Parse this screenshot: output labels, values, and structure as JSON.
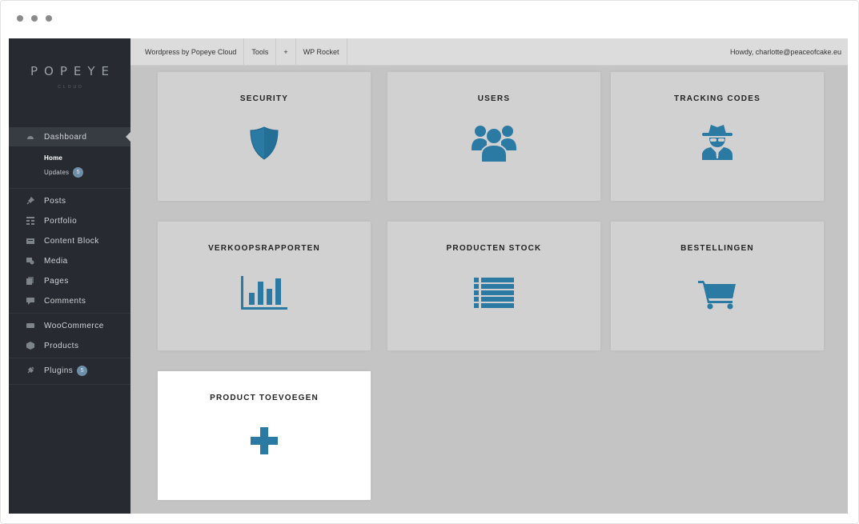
{
  "theme": {
    "accent": "#2a7aa3",
    "sidebar_bg": "#272b31",
    "content_bg": "#c4c4c4"
  },
  "brand": {
    "logo_text": "POPEYE",
    "logo_sub": "CLOUD"
  },
  "sidebar": {
    "items": [
      {
        "label": "Dashboard",
        "icon": "dashboard-icon",
        "active": true
      },
      {
        "label": "Posts",
        "icon": "pin-icon"
      },
      {
        "label": "Portfolio",
        "icon": "grid-icon"
      },
      {
        "label": "Content Block",
        "icon": "block-icon"
      },
      {
        "label": "Media",
        "icon": "media-icon"
      },
      {
        "label": "Pages",
        "icon": "pages-icon"
      },
      {
        "label": "Comments",
        "icon": "comment-icon"
      },
      {
        "label": "WooCommerce",
        "icon": "woocommerce-icon"
      },
      {
        "label": "Products",
        "icon": "box-icon"
      },
      {
        "label": "Plugins",
        "icon": "plug-icon",
        "badge": "5"
      }
    ],
    "submenu": [
      {
        "label": "Home",
        "current": true
      },
      {
        "label": "Updates",
        "badge": "5"
      }
    ]
  },
  "topbar": {
    "site": "Wordpress by Popeye Cloud",
    "tools": "Tools",
    "plus": "+",
    "rocket": "WP Rocket",
    "howdy": "Howdy, charlotte@peaceofcake.eu"
  },
  "tiles": [
    {
      "label": "SECURITY",
      "icon": "shield-icon"
    },
    {
      "label": "USERS",
      "icon": "users-icon"
    },
    {
      "label": "TRACKING CODES",
      "icon": "spy-icon"
    },
    {
      "label": "VERKOOPSRAPPORTEN",
      "icon": "bar-chart-icon"
    },
    {
      "label": "PRODUCTEN STOCK",
      "icon": "list-icon"
    },
    {
      "label": "BESTELLINGEN",
      "icon": "cart-icon"
    },
    {
      "label": "PRODUCT TOEVOEGEN",
      "icon": "plus-icon",
      "highlighted": true
    }
  ]
}
